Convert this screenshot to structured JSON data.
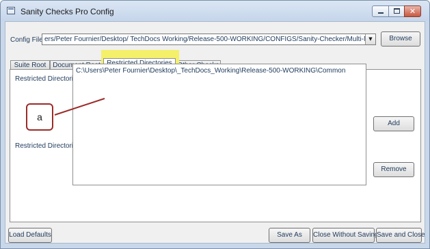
{
  "window": {
    "title": "Sanity Checks Pro Config"
  },
  "config": {
    "label": "Config File:",
    "path": "ers/Peter Fournier/Desktop/  TechDocs  Working/Release-500-WORKING/CONFIGS/Sanity-Checker/Multi-Node-Man.config",
    "browse_label": "Browse"
  },
  "tabs": [
    {
      "label": "Suite Root"
    },
    {
      "label": "Document Root"
    },
    {
      "label": "Restricted Directories",
      "active": true
    },
    {
      "label": "Other Checks"
    }
  ],
  "panel": {
    "checkbox_label": "Restricted Directories",
    "checkbox_checked": true,
    "checkbox_glyph": "✓",
    "list_label": "Restricted Directories:",
    "list_items": [
      "C:\\Users\\Peter Fournier\\Desktop\\_TechDocs_Working\\Release-500-WORKING\\Common"
    ],
    "add_label": "Add",
    "remove_label": "Remove"
  },
  "callout": {
    "text": "a",
    "border_color": "#9b2b28"
  },
  "highlight_color": "#f4f06a",
  "footer": {
    "load_defaults": "Load Defaults",
    "save_as": "Save As",
    "close_without_saving": "Close Without Saving",
    "save_and_close": "Save and Close"
  }
}
